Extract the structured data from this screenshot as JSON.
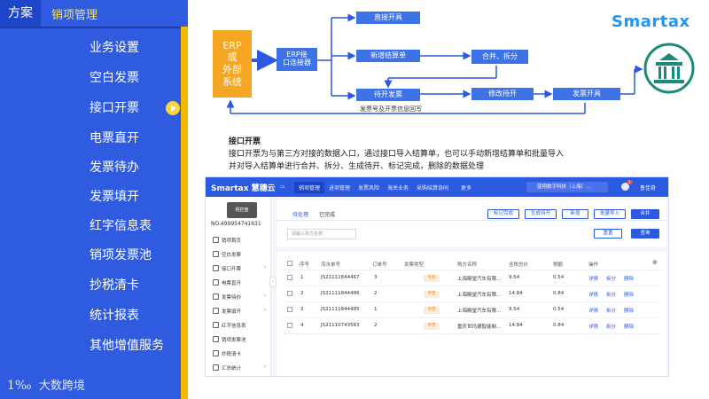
{
  "header": {
    "tab_fangan": "方案",
    "tab_xiaoxiang": "销项管理"
  },
  "menu": {
    "items": [
      {
        "label": "业务设置"
      },
      {
        "label": "空白发票"
      },
      {
        "label": "接口开票",
        "active": true
      },
      {
        "label": "电票直开"
      },
      {
        "label": "发票待办"
      },
      {
        "label": "发票填开"
      },
      {
        "label": "红字信息表"
      },
      {
        "label": "销项发票池"
      },
      {
        "label": "抄税清卡"
      },
      {
        "label": "统计报表"
      },
      {
        "label": "其他增值服务"
      }
    ]
  },
  "footer_logo": {
    "mark": "1‰",
    "text": "大数跨境"
  },
  "flow": {
    "erp": "ERP\n或\n外部\n系统",
    "interface": "ERP接\n口连接器",
    "direct": "直接开具",
    "new_settlement": "新增结算单",
    "merge_split": "合并、拆分",
    "pending": "待开发票",
    "modify_pending": "修改待开",
    "issue": "发票开具",
    "note": "发票号及开票信息回写"
  },
  "brand": {
    "name": "Smartax"
  },
  "colors": {
    "panel_blue": "#2f5be0",
    "accent_yellow": "#f5b700",
    "erp_orange": "#f5a623",
    "flow_blue": "#3d73e6",
    "highlight_text": "#ffe24a"
  },
  "description": {
    "title": "接口开票",
    "lines": [
      "接口开票为与第三方对接的数据入口，通过接口导入结算单，也可以手动新增结算单和批量导入",
      "并对导入结算单进行合并、拆分、生成待开、标记完成，删除的数据处理"
    ]
  },
  "app": {
    "brand": "Smartax 慧穗云",
    "nav": [
      "销项管理",
      "进项管理",
      "发票风险",
      "海关业务",
      "采购结算协同",
      "更多"
    ],
    "company": "蓝翔数字科技（上海）...",
    "user": "鲁佳奇",
    "bell_count": "1",
    "card_label": "税控盘",
    "device_no": "NO.499954741631",
    "side_items": [
      {
        "label": "销项首页"
      },
      {
        "label": "空白发票"
      },
      {
        "label": "接口开票",
        "chev": true
      },
      {
        "label": "电票直开"
      },
      {
        "label": "发票待办",
        "chev": true
      },
      {
        "label": "发票填开",
        "chev": true
      },
      {
        "label": "红字信息表"
      },
      {
        "label": "销项发票池"
      },
      {
        "label": "抄税清卡"
      },
      {
        "label": "汇总统计",
        "chev": true
      },
      {
        "label": "统计报表"
      }
    ],
    "tabs": [
      "待处理",
      "已完成"
    ],
    "buttons": {
      "mark_done": "标记完成",
      "gen_pending": "生成待开",
      "add": "新增",
      "batch_import": "批量导入",
      "merge": "合并",
      "reset": "重置",
      "search": "查询"
    },
    "search_placeholder": "请输入购方名称",
    "table": {
      "headers": [
        "序号",
        "流水单号",
        "订单号",
        "发票类型",
        "购方名称",
        "含税总价",
        "税额",
        "操作"
      ],
      "rows": [
        {
          "no": "1",
          "serial": "JS21111844467",
          "order": "3",
          "type": "专票",
          "buyer": "上海殿堂汽车有限...",
          "total": "9.54",
          "tax": "0.54",
          "ops": [
            "详情",
            "拆分",
            "删除"
          ]
        },
        {
          "no": "2",
          "serial": "JS21111844486",
          "order": "2",
          "type": "专票",
          "buyer": "上海殿堂汽车有限...",
          "total": "14.84",
          "tax": "0.84",
          "ops": [
            "详情",
            "拆分",
            "删除"
          ]
        },
        {
          "no": "3",
          "serial": "JS21111844485",
          "order": "1",
          "type": "专票",
          "buyer": "上海殿堂汽车有限...",
          "total": "9.54",
          "tax": "0.54",
          "ops": [
            "详情",
            "拆分",
            "删除"
          ]
        },
        {
          "no": "4",
          "serial": "JS21110743583",
          "order": "2",
          "type": "专票",
          "buyer": "重庆世玛德智能制...",
          "total": "14.84",
          "tax": "0.84",
          "ops": [
            "详情",
            "拆分",
            "删除"
          ]
        }
      ]
    }
  }
}
